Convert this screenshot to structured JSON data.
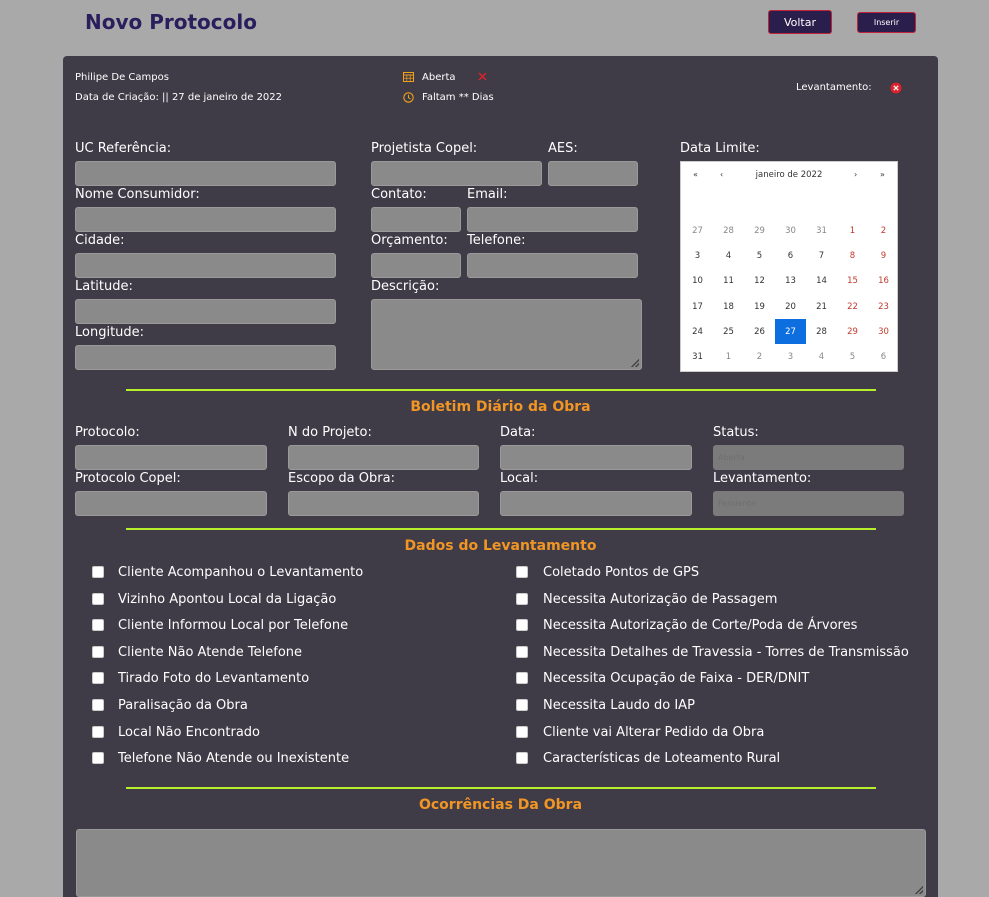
{
  "header": {
    "title": "Novo Protocolo",
    "back_label": "Voltar",
    "insert_label": "Inserir"
  },
  "info": {
    "user": "Philipe De Campos",
    "created": "Data de Criação: || 27 de janeiro de 2022",
    "status": "Aberta",
    "remaining": "Faltam ** Dias",
    "survey_label": "Levantamento:"
  },
  "form": {
    "uc_label": "UC Referência:",
    "consumer_label": "Nome Consumidor:",
    "city_label": "Cidade:",
    "lat_label": "Latitude:",
    "lon_label": "Longitude:",
    "designer_label": "Projetista Copel:",
    "aes_label": "AES:",
    "contact_label": "Contato:",
    "email_label": "Email:",
    "budget_label": "Orçamento:",
    "phone_label": "Telefone:",
    "desc_label": "Descrição:",
    "deadline_label": "Data Limite:"
  },
  "calendar": {
    "prev_year": "«",
    "prev_month": "‹",
    "title": "janeiro de 2022",
    "next_month": "›",
    "next_year": "»",
    "days": [
      [
        "27",
        "28",
        "29",
        "30",
        "31",
        "1",
        "2"
      ],
      [
        "3",
        "4",
        "5",
        "6",
        "7",
        "8",
        "9"
      ],
      [
        "10",
        "11",
        "12",
        "13",
        "14",
        "15",
        "16"
      ],
      [
        "17",
        "18",
        "19",
        "20",
        "21",
        "22",
        "23"
      ],
      [
        "24",
        "25",
        "26",
        "27",
        "28",
        "29",
        "30"
      ],
      [
        "31",
        "1",
        "2",
        "3",
        "4",
        "5",
        "6"
      ]
    ],
    "selected": "27"
  },
  "boletim": {
    "title": "Boletim Diário da Obra",
    "protocol_label": "Protocolo:",
    "project_label": "N do Projeto:",
    "date_label": "Data:",
    "status_label": "Status:",
    "status_value": "Aberta",
    "copel_protocol_label": "Protocolo Copel:",
    "scope_label": "Escopo da Obra:",
    "local_label": "Local:",
    "survey_label": "Levantamento:",
    "survey_value": "Pendente"
  },
  "dados": {
    "title": "Dados do Levantamento",
    "left": [
      "Cliente Acompanhou o Levantamento",
      "Vizinho Apontou Local da Ligação",
      "Cliente Informou Local por Telefone",
      "Cliente Não Atende Telefone",
      "Tirado Foto do Levantamento",
      "Paralisação da Obra",
      "Local Não Encontrado",
      "Telefone Não Atende ou Inexistente"
    ],
    "right": [
      "Coletado Pontos de GPS",
      "Necessita Autorização de Passagem",
      "Necessita Autorização de Corte/Poda de Árvores",
      "Necessita Detalhes de Travessia - Torres de Transmissão",
      "Necessita Ocupação de Faixa - DER/DNIT",
      "Necessita Laudo do IAP",
      "Cliente vai Alterar Pedido da Obra",
      "Características de Loteamento Rural"
    ]
  },
  "ocorrencias": {
    "title": "Ocorrências Da Obra"
  },
  "colors": {
    "background": "#a9a9a9",
    "card": "#3f3c47",
    "accent_orange": "#f19524",
    "divider_green": "#b6f02a",
    "button_bg": "#2a1f4c",
    "button_border": "#c0223a",
    "calendar_selected": "#0d6ee0"
  }
}
